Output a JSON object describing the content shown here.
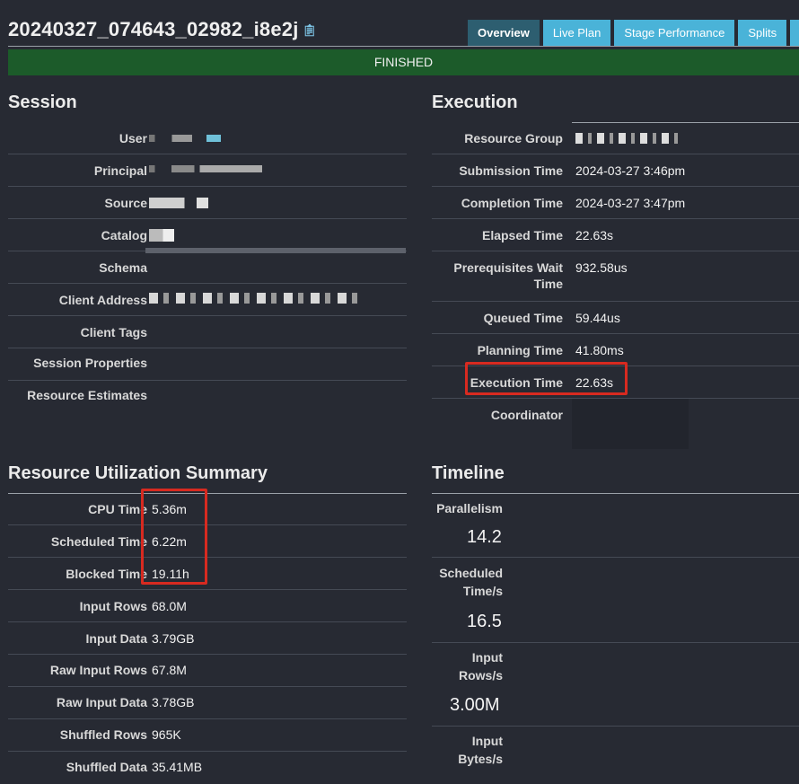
{
  "header": {
    "query_id": "20240327_074643_02982_i8e2j",
    "tabs": [
      "Overview",
      "Live Plan",
      "Stage Performance",
      "Splits",
      "J"
    ],
    "status": "FINISHED"
  },
  "session": {
    "title": "Session",
    "rows": [
      {
        "label": "User",
        "value": ""
      },
      {
        "label": "Principal",
        "value": ""
      },
      {
        "label": "Source",
        "value": ""
      },
      {
        "label": "Catalog",
        "value": ""
      },
      {
        "label": "Schema",
        "value": ""
      },
      {
        "label": "Client Address",
        "value": ""
      },
      {
        "label": "Client Tags",
        "value": ""
      },
      {
        "label": "Session Properties",
        "value": ""
      },
      {
        "label": "Resource Estimates",
        "value": ""
      }
    ]
  },
  "execution": {
    "title": "Execution",
    "rows": [
      {
        "label": "Resource Group",
        "value": ""
      },
      {
        "label": "Submission Time",
        "value": "2024-03-27 3:46pm"
      },
      {
        "label": "Completion Time",
        "value": "2024-03-27 3:47pm"
      },
      {
        "label": "Elapsed Time",
        "value": "22.63s"
      },
      {
        "label": "Prerequisites Wait Time",
        "value": "932.58us"
      },
      {
        "label": "Queued Time",
        "value": "59.44us"
      },
      {
        "label": "Planning Time",
        "value": "41.80ms"
      },
      {
        "label": "Execution Time",
        "value": "22.63s"
      },
      {
        "label": "Coordinator",
        "value": ""
      }
    ]
  },
  "resources": {
    "title": "Resource Utilization Summary",
    "rows": [
      {
        "label": "CPU Time",
        "value": "5.36m"
      },
      {
        "label": "Scheduled Time",
        "value": "6.22m"
      },
      {
        "label": "Blocked Time",
        "value": "19.11h"
      },
      {
        "label": "Input Rows",
        "value": "68.0M"
      },
      {
        "label": "Input Data",
        "value": "3.79GB"
      },
      {
        "label": "Raw Input Rows",
        "value": "67.8M"
      },
      {
        "label": "Raw Input Data",
        "value": "3.78GB"
      },
      {
        "label": "Shuffled Rows",
        "value": "965K"
      },
      {
        "label": "Shuffled Data",
        "value": "35.41MB"
      }
    ]
  },
  "timeline": {
    "title": "Timeline",
    "items": [
      {
        "label": "Parallelism",
        "value": "14.2"
      },
      {
        "label": "Scheduled Time/s",
        "value": "16.5"
      },
      {
        "label": "Input Rows/s",
        "value": "3.00M"
      },
      {
        "label": "Input Bytes/s",
        "value": ""
      }
    ]
  },
  "colors": {
    "background": "#272a33",
    "tab_active": "#2d5e70",
    "tab": "#4ab3d8",
    "status_bar": "#1c5b2a",
    "highlight": "#d82a20"
  }
}
